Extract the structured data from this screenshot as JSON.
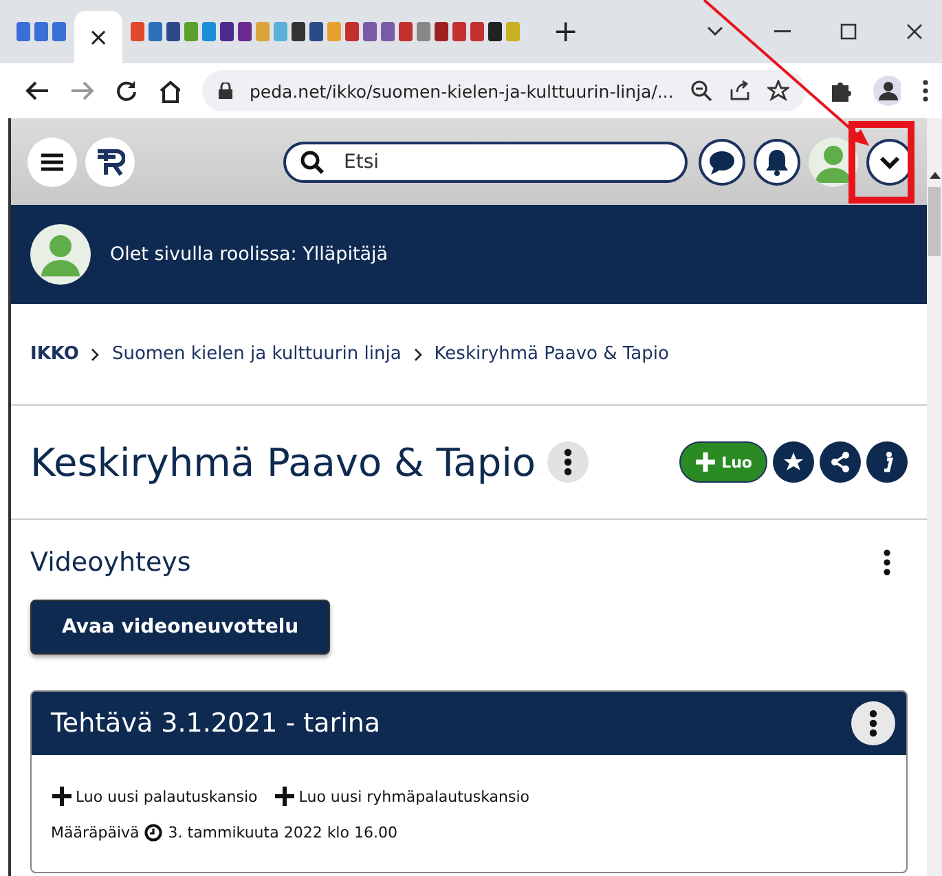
{
  "browser": {
    "tab_close": "×",
    "new_tab": "+",
    "url": "peda.net/ikko/suomen-kielen-ja-kulttuurin-linja/..."
  },
  "header": {
    "search": {
      "placeholder": "Etsi"
    }
  },
  "role_banner": {
    "text": "Olet sivulla roolissa: Ylläpitäjä"
  },
  "breadcrumb": [
    "IKKO",
    "Suomen kielen ja kulttuurin linja",
    "Keskiryhmä Paavo & Tapio"
  ],
  "page": {
    "title": "Keskiryhmä Paavo & Tapio",
    "create_button": "Luo"
  },
  "section": {
    "title": "Videoyhteys",
    "button": "Avaa videoneuvottelu"
  },
  "task_card": {
    "title": "Tehtävä 3.1.2021 - tarina",
    "actions": [
      "Luo uusi palautuskansio",
      "Luo uusi ryhmäpalautuskansio"
    ],
    "due_label": "Määräpäivä",
    "due_date": "3. tammikuuta 2022 klo 16.00"
  }
}
